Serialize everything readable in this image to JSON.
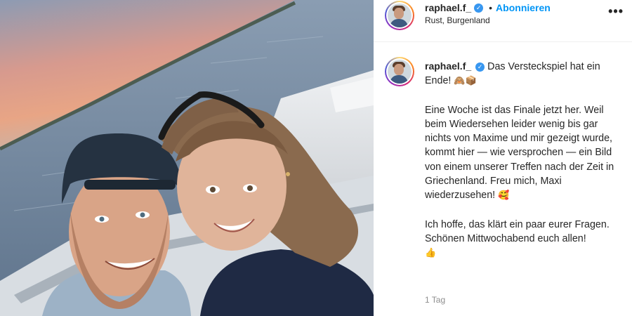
{
  "post": {
    "photo": {
      "description_icon": "selfie-photo"
    },
    "header": {
      "username": "raphael.f_",
      "verified_icon": "verified-badge-icon",
      "separator": "•",
      "follow_label": "Abonnieren",
      "location": "Rust, Burgenland",
      "more_icon": "more-options-icon",
      "more_glyph": "•••"
    },
    "caption": {
      "username": "raphael.f_",
      "line1": "Das Versteckspiel hat ein Ende!",
      "line1_emoji": "🙈📦",
      "para2": "Eine Woche ist das Finale jetzt her. Weil beim Wiedersehen leider wenig bis gar nichts von Maxime und mir gezeigt wurde, kommt hier — wie versprochen — ein Bild von einem unserer Treffen nach der Zeit in Griechenland. Freu mich, Maxi wiederzusehen!",
      "para2_emoji": "🥰",
      "para3_line1": "Ich hoffe, das klärt ein paar eurer Fragen.",
      "para3_line2": "Schönen Mittwochabend euch allen!",
      "para3_emoji": "👍"
    },
    "timestamp": "1 Tag",
    "colors": {
      "link_blue": "#0095f6",
      "verified_blue": "#3897f0",
      "muted_text": "#8e8e8e"
    }
  }
}
